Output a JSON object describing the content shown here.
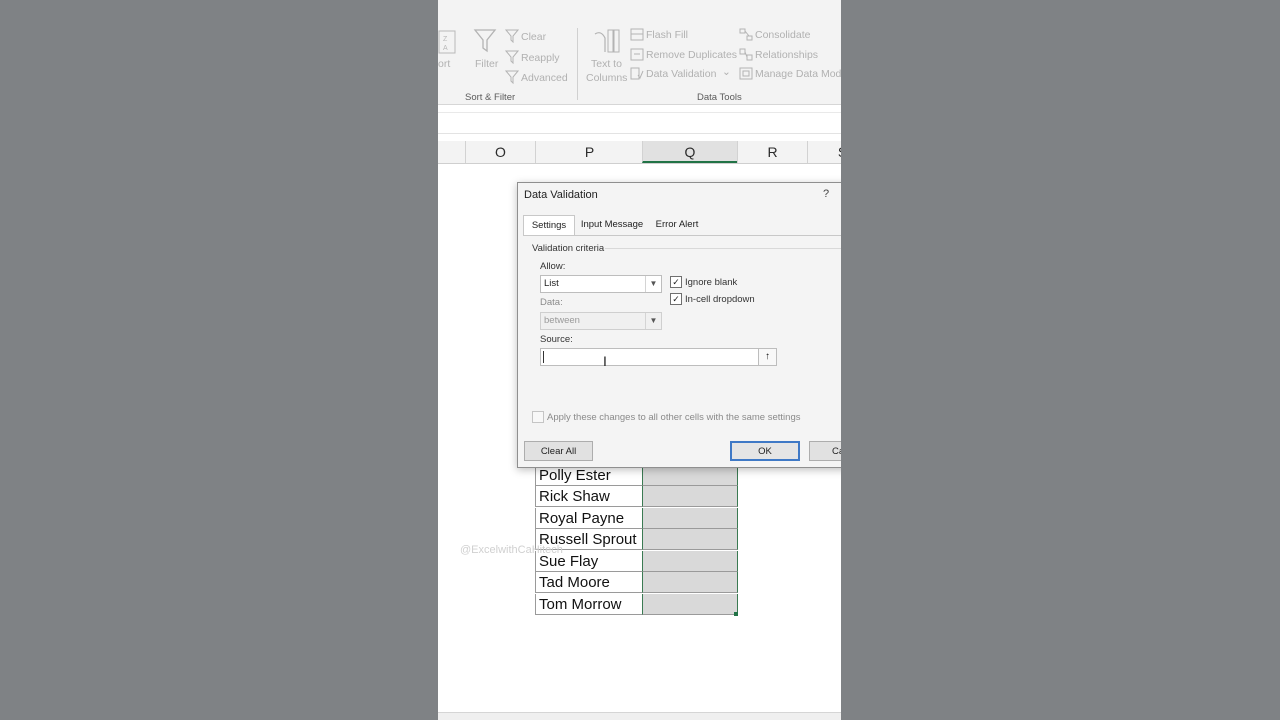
{
  "ribbon": {
    "sort_label": "ort",
    "filter_label": "Filter",
    "clear_label": "Clear",
    "reapply_label": "Reapply",
    "advanced_label": "Advanced",
    "sort_filter_group": "Sort & Filter",
    "text_to_columns_line1": "Text to",
    "text_to_columns_line2": "Columns",
    "flash_fill_label": "Flash Fill",
    "remove_duplicates_label": "Remove Duplicates",
    "data_validation_label": "Data Validation",
    "data_validation_dropdown": "⌄",
    "consolidate_label": "Consolidate",
    "relationships_label": "Relationships",
    "manage_data_model_label": "Manage Data Mode",
    "data_tools_group": "Data Tools"
  },
  "columns": [
    "O",
    "P",
    "Q",
    "R",
    "S"
  ],
  "selected_column": "Q",
  "names": [
    "Polly Ester",
    "Rick Shaw",
    "Royal Payne",
    "Russell Sprout",
    "Sue Flay",
    "Tad Moore",
    "Tom Morrow"
  ],
  "watermark": "@ExcelwithCaHitech",
  "dialog": {
    "title": "Data Validation",
    "help": "?",
    "tabs": [
      "Settings",
      "Input Message",
      "Error Alert"
    ],
    "active_tab": "Settings",
    "group_label": "Validation criteria",
    "allow_label": "Allow:",
    "allow_value": "List",
    "data_label": "Data:",
    "data_value": "between",
    "ignore_blank_label": "Ignore blank",
    "ignore_blank_checked": true,
    "in_cell_dropdown_label": "In-cell dropdown",
    "in_cell_dropdown_checked": true,
    "source_label": "Source:",
    "source_value": "",
    "apply_all_label": "Apply these changes to all other cells with the same settings",
    "apply_all_checked": false,
    "clear_all_button": "Clear All",
    "ok_button": "OK",
    "cancel_button": "Ca"
  }
}
